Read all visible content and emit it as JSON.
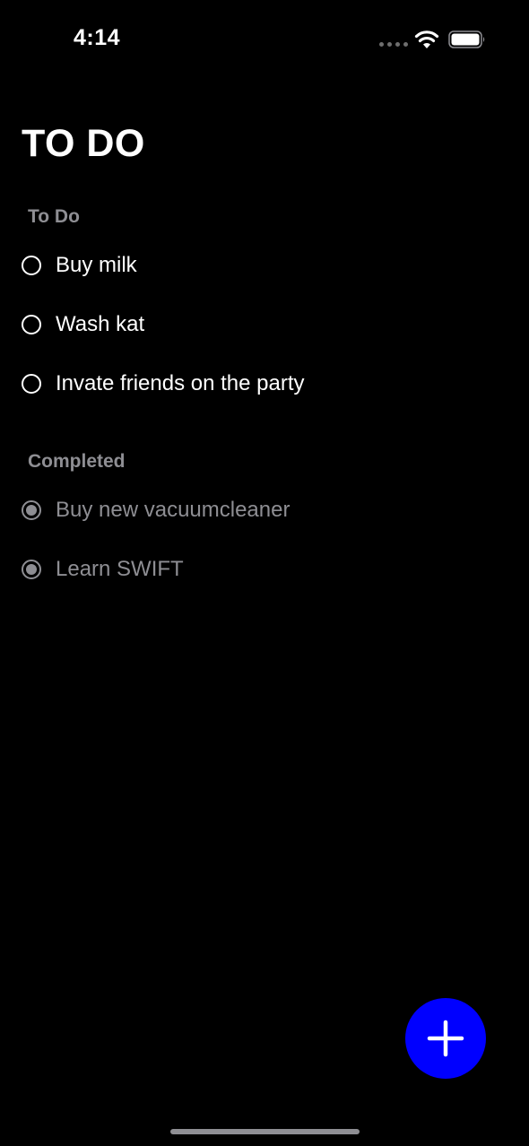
{
  "status_bar": {
    "time": "4:14"
  },
  "title": "TO DO",
  "sections": {
    "todo": {
      "header": "To Do",
      "items": [
        {
          "label": "Buy milk",
          "completed": false
        },
        {
          "label": "Wash kat",
          "completed": false
        },
        {
          "label": "Invate friends on the party",
          "completed": false
        }
      ]
    },
    "completed": {
      "header": "Completed",
      "items": [
        {
          "label": "Buy new vacuumcleaner",
          "completed": true
        },
        {
          "label": "Learn SWIFT",
          "completed": true
        }
      ]
    }
  },
  "fab": {
    "icon": "plus-icon"
  },
  "colors": {
    "background": "#000000",
    "text": "#ffffff",
    "muted": "#8e8e93",
    "accent": "#0000ff"
  }
}
